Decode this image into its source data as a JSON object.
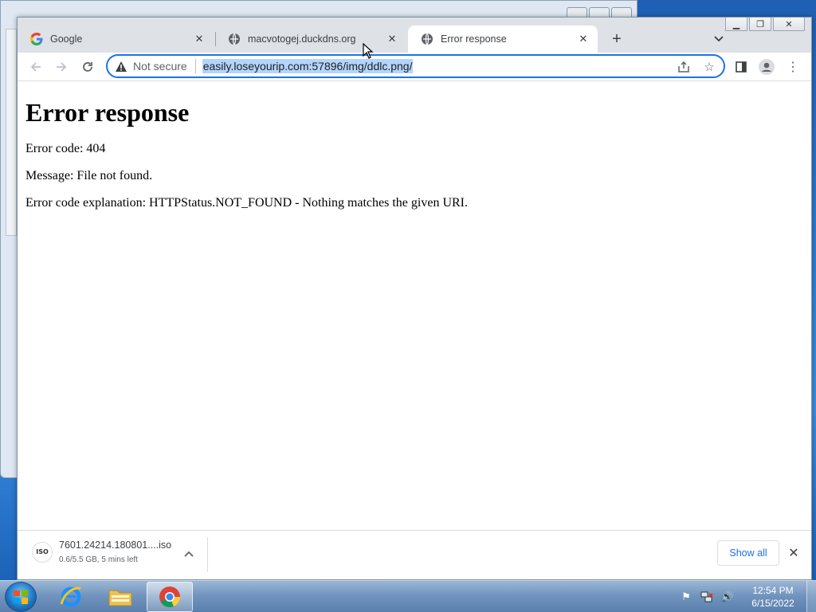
{
  "browser": {
    "tabs": [
      {
        "title": "Google",
        "icon": "google-icon",
        "active": false
      },
      {
        "title": "macvotogej.duckdns.org",
        "icon": "globe-icon",
        "active": false
      },
      {
        "title": "Error response",
        "icon": "globe-icon",
        "active": true
      }
    ],
    "omnibox": {
      "security_label": "Not secure",
      "url": "easily.loseyourip.com:57896/img/ddlc.png/"
    }
  },
  "page": {
    "heading": "Error response",
    "error_code": "Error code: 404",
    "message": "Message: File not found.",
    "explanation": "Error code explanation: HTTPStatus.NOT_FOUND - Nothing matches the given URI."
  },
  "download_bar": {
    "file_name": "7601.24214.180801....iso",
    "status": "0.6/5.5 GB, 5 mins left",
    "file_badge": "ISO",
    "show_all_label": "Show all"
  },
  "taskbar": {
    "clock_time": "12:54 PM",
    "clock_date": "6/15/2022"
  },
  "colors": {
    "accent": "#1a73e8",
    "url_selection": "#b3d4fc",
    "tabstrip": "#dee1e6"
  }
}
